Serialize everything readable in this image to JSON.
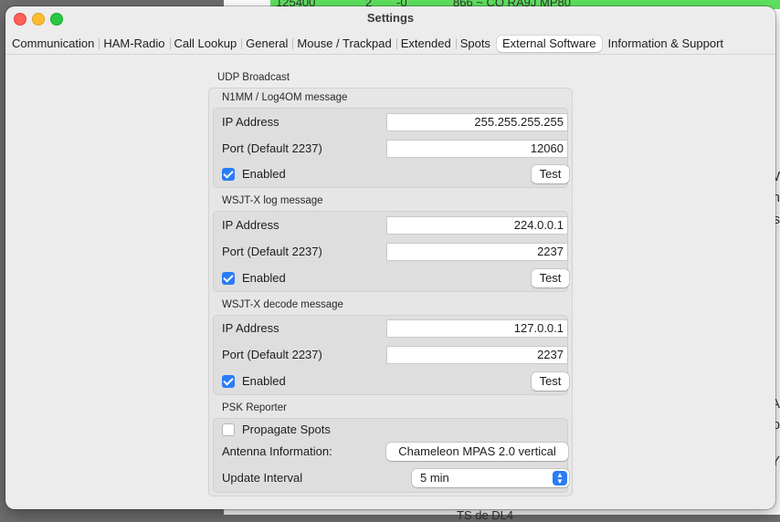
{
  "background": {
    "top_row": [
      "125400",
      "2",
      "-0",
      "866 ~ CQ RA9J MP80"
    ],
    "edge_chars": [
      "W",
      "th",
      "is",
      "A",
      "p",
      "Y"
    ],
    "bottom_text": "TS de DL4"
  },
  "window": {
    "title": "Settings"
  },
  "tabs": [
    {
      "label": "Communication",
      "selected": false
    },
    {
      "label": "HAM-Radio",
      "selected": false
    },
    {
      "label": "Call Lookup",
      "selected": false
    },
    {
      "label": "General",
      "selected": false
    },
    {
      "label": "Mouse / Trackpad",
      "selected": false
    },
    {
      "label": "Extended",
      "selected": false
    },
    {
      "label": "Spots",
      "selected": false
    },
    {
      "label": "External Software",
      "selected": true
    },
    {
      "label": "Information & Support",
      "selected": false
    }
  ],
  "udp": {
    "title": "UDP Broadcast",
    "n1mm": {
      "title": "N1MM / Log4OM message",
      "ip_label": "IP Address",
      "ip_value": "255.255.255.255",
      "port_label": "Port (Default 2237)",
      "port_value": "12060",
      "enabled_label": "Enabled",
      "enabled": true,
      "test_label": "Test"
    },
    "wsjtx_log": {
      "title": "WSJT-X log message",
      "ip_label": "IP Address",
      "ip_value": "224.0.0.1",
      "port_label": "Port (Default 2237)",
      "port_value": "2237",
      "enabled_label": "Enabled",
      "enabled": true,
      "test_label": "Test"
    },
    "wsjtx_decode": {
      "title": "WSJT-X decode message",
      "ip_label": "IP Address",
      "ip_value": "127.0.0.1",
      "port_label": "Port (Default 2237)",
      "port_value": "2237",
      "enabled_label": "Enabled",
      "enabled": true,
      "test_label": "Test"
    }
  },
  "psk": {
    "title": "PSK Reporter",
    "propagate_label": "Propagate Spots",
    "propagate": false,
    "antenna_label": "Antenna Information:",
    "antenna_value": "Chameleon MPAS 2.0 vertical",
    "interval_label": "Update Interval",
    "interval_value": "5 min"
  },
  "colors": {
    "accent": "#2a7cf6",
    "close": "#fe5f57",
    "minimize": "#febc2e",
    "maximize": "#28c840",
    "bg_highlight": "#5fe35f"
  }
}
